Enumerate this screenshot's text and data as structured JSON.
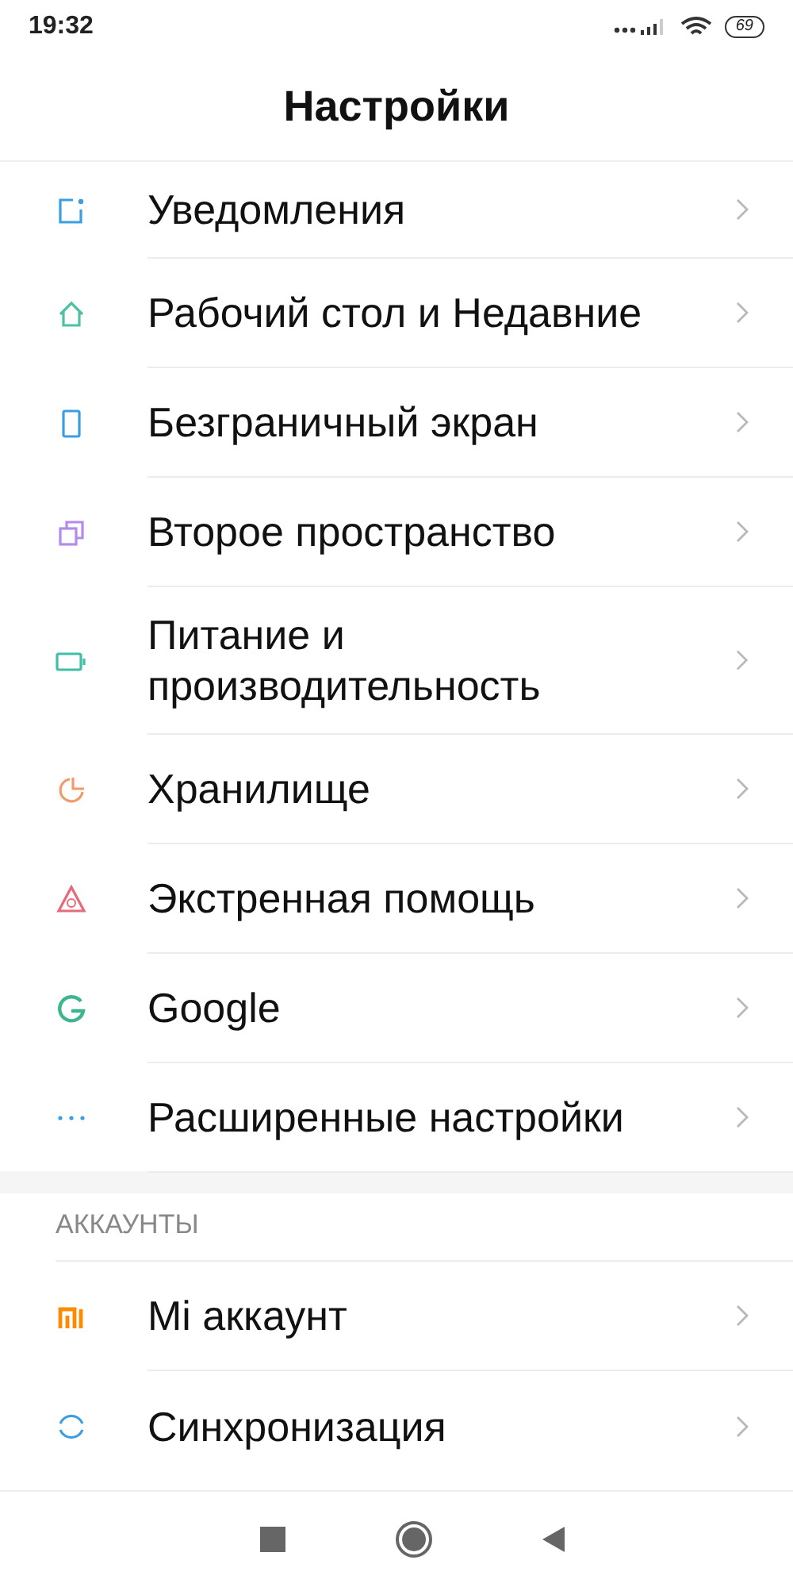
{
  "status_bar": {
    "time": "19:32",
    "battery": "69"
  },
  "title": "Настройки",
  "sections": [
    {
      "items": [
        {
          "label": "Уведомления"
        },
        {
          "label": "Рабочий стол и Недавние"
        },
        {
          "label": "Безграничный экран"
        },
        {
          "label": "Второе пространство"
        },
        {
          "label": "Питание и производительность"
        },
        {
          "label": "Хранилище"
        },
        {
          "label": "Экстренная помощь"
        },
        {
          "label": "Google"
        },
        {
          "label": "Расширенные настройки"
        }
      ]
    },
    {
      "header": "АККАУНТЫ",
      "items": [
        {
          "label": "Mi аккаунт"
        },
        {
          "label": "Синхронизация"
        }
      ]
    }
  ]
}
